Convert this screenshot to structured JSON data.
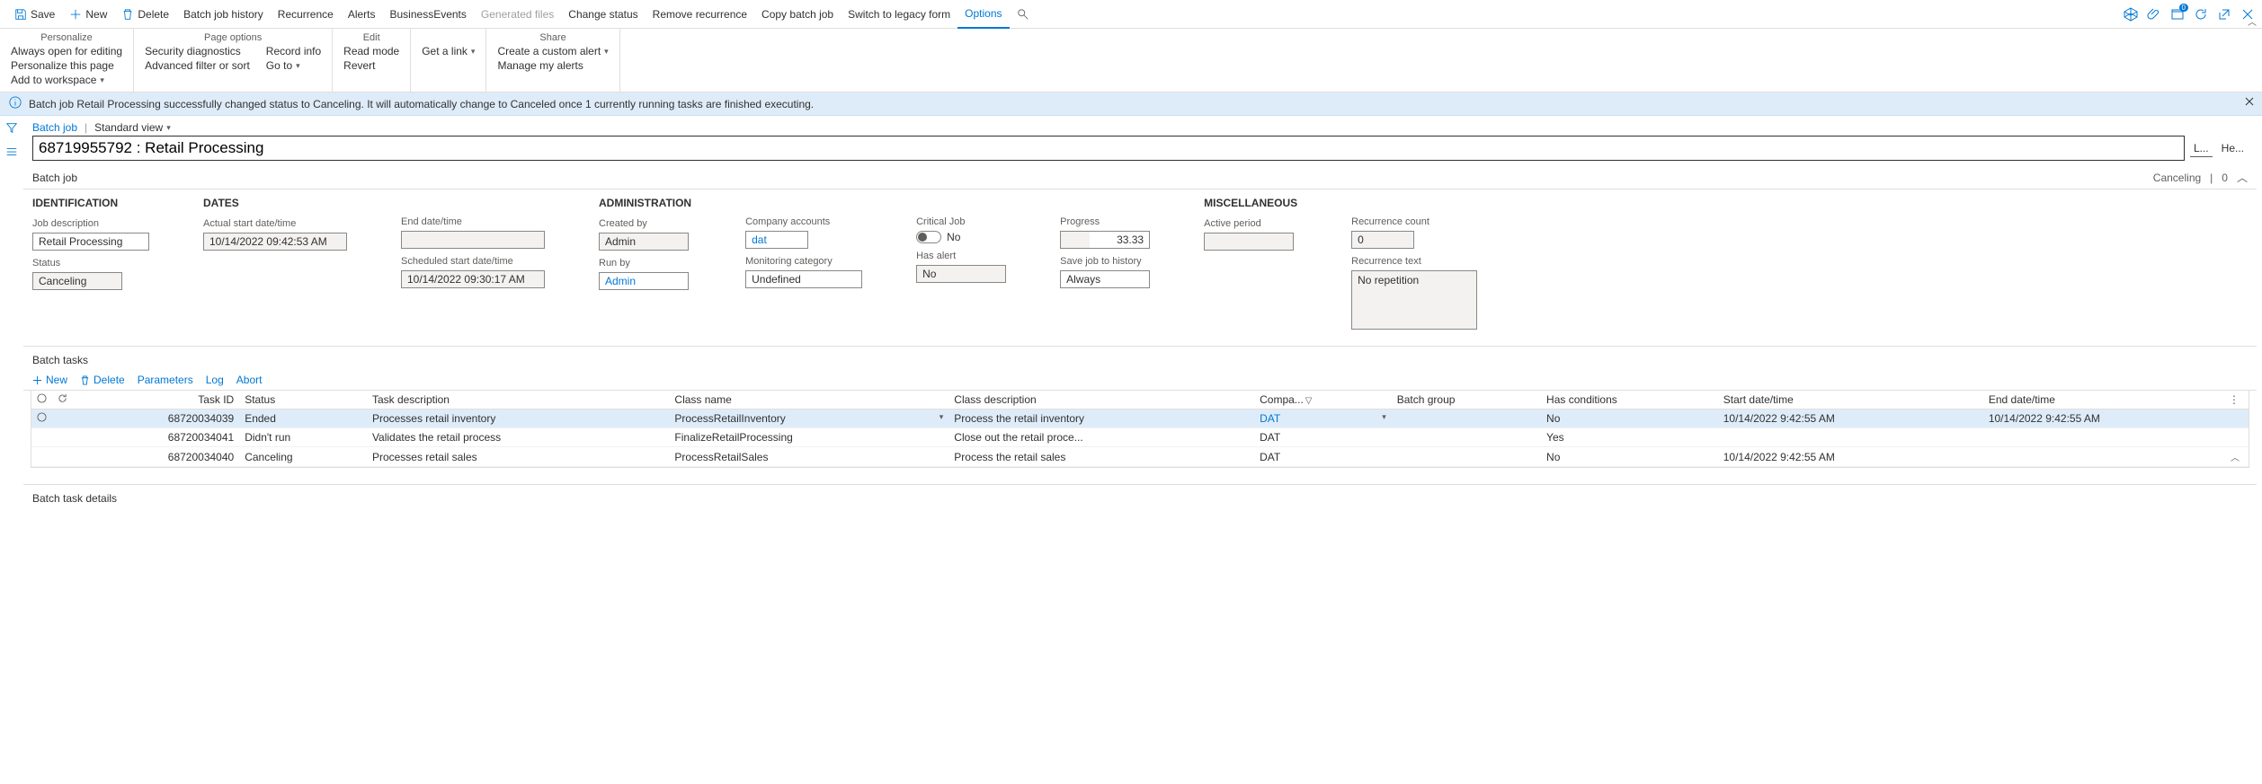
{
  "topbar": {
    "save": "Save",
    "new": "New",
    "delete": "Delete",
    "history": "Batch job history",
    "recurrence": "Recurrence",
    "alerts": "Alerts",
    "business_events": "BusinessEvents",
    "generated_files": "Generated files",
    "change_status": "Change status",
    "remove_recurrence": "Remove recurrence",
    "copy": "Copy batch job",
    "switch": "Switch to legacy form",
    "options": "Options"
  },
  "ribbon": {
    "personalize": {
      "title": "Personalize",
      "always_open": "Always open for editing",
      "personalize_page": "Personalize this page",
      "add_workspace": "Add to workspace"
    },
    "page_options": {
      "title": "Page options",
      "security": "Security diagnostics",
      "filter": "Advanced filter or sort",
      "record_info": "Record info",
      "go_to": "Go to"
    },
    "edit": {
      "title": "Edit",
      "read_mode": "Read mode",
      "revert": "Revert"
    },
    "get_link": "Get a link",
    "share": {
      "title": "Share",
      "custom_alert": "Create a custom alert",
      "my_alerts": "Manage my alerts"
    }
  },
  "message": "Batch job Retail Processing successfully changed status to Canceling. It will automatically change to Canceled once 1 currently running tasks are finished executing.",
  "breadcrumb": {
    "root": "Batch job",
    "view": "Standard view"
  },
  "title_value": "68719955792 : Retail Processing",
  "title_btn1": "L...",
  "title_btn2": "He...",
  "section_header": {
    "title": "Batch job",
    "status": "Canceling",
    "count": "0"
  },
  "fields": {
    "identification": {
      "title": "IDENTIFICATION",
      "job_desc_label": "Job description",
      "job_desc": "Retail Processing",
      "status_label": "Status",
      "status": "Canceling"
    },
    "dates": {
      "title": "DATES",
      "actual_label": "Actual start date/time",
      "actual": "10/14/2022 09:42:53 AM",
      "end_label": "End date/time",
      "end": "",
      "sched_label": "Scheduled start date/time",
      "sched": "10/14/2022 09:30:17 AM"
    },
    "admin": {
      "title": "ADMINISTRATION",
      "created_by_label": "Created by",
      "created_by": "Admin",
      "run_by_label": "Run by",
      "run_by": "Admin"
    },
    "company": {
      "accounts_label": "Company accounts",
      "accounts": "dat",
      "monitoring_label": "Monitoring category",
      "monitoring": "Undefined"
    },
    "critical": {
      "critical_label": "Critical Job",
      "critical_val": "No",
      "has_alert_label": "Has alert",
      "has_alert": "No"
    },
    "progress": {
      "progress_label": "Progress",
      "progress_val": "33.33",
      "save_label": "Save job to history",
      "save_val": "Always"
    },
    "misc": {
      "title": "MISCELLANEOUS",
      "active_label": "Active period",
      "active": ""
    },
    "recurrence": {
      "count_label": "Recurrence count",
      "count": "0",
      "text_label": "Recurrence text",
      "text": "No repetition"
    }
  },
  "tasks_section": "Batch tasks",
  "tasks_toolbar": {
    "new": "New",
    "delete": "Delete",
    "parameters": "Parameters",
    "log": "Log",
    "abort": "Abort"
  },
  "tasks_columns": {
    "task_id": "Task ID",
    "status": "Status",
    "desc": "Task description",
    "class_name": "Class name",
    "class_desc": "Class description",
    "company": "Compa...",
    "batch_group": "Batch group",
    "has_cond": "Has conditions",
    "start": "Start date/time",
    "end": "End date/time"
  },
  "tasks": [
    {
      "id": "68720034039",
      "status": "Ended",
      "desc": "Processes retail inventory",
      "class_name": "ProcessRetailInventory",
      "class_desc": "Process the retail inventory",
      "company": "DAT",
      "group": "",
      "cond": "No",
      "start": "10/14/2022 9:42:55 AM",
      "end": "10/14/2022 9:42:55 AM"
    },
    {
      "id": "68720034041",
      "status": "Didn't run",
      "desc": "Validates the retail process",
      "class_name": "FinalizeRetailProcessing",
      "class_desc": "Close out the retail proce...",
      "company": "DAT",
      "group": "",
      "cond": "Yes",
      "start": "",
      "end": ""
    },
    {
      "id": "68720034040",
      "status": "Canceling",
      "desc": "Processes retail sales",
      "class_name": "ProcessRetailSales",
      "class_desc": "Process the retail sales",
      "company": "DAT",
      "group": "",
      "cond": "No",
      "start": "10/14/2022 9:42:55 AM",
      "end": ""
    }
  ],
  "details_section": "Batch task details"
}
